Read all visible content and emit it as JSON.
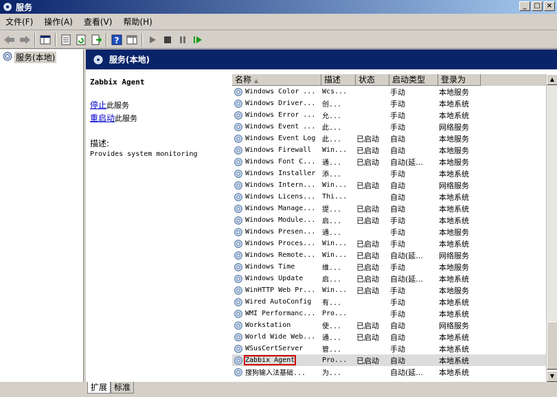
{
  "window": {
    "title": "服务",
    "min": "_",
    "max": "□",
    "close": "×"
  },
  "menu": [
    {
      "label": "文件(F)"
    },
    {
      "label": "操作(A)"
    },
    {
      "label": "查看(V)"
    },
    {
      "label": "帮助(H)"
    }
  ],
  "tree": {
    "label": "服务(本地)"
  },
  "header": {
    "title": "服务(本地)"
  },
  "details": {
    "service_name": "Zabbix Agent",
    "stop_link": "停止",
    "stop_text": "此服务",
    "restart_link": "重启动",
    "restart_text": "此服务",
    "desc_label": "描述:",
    "desc_text": "Provides system monitoring"
  },
  "columns": {
    "name": "名称",
    "desc": "描述",
    "status": "状态",
    "start": "启动类型",
    "logon": "登录为"
  },
  "rows": [
    {
      "name": "Windows Color ...",
      "desc": "Wcs...",
      "status": "",
      "start": "手动",
      "logon": "本地服务"
    },
    {
      "name": "Windows Driver...",
      "desc": "创...",
      "status": "",
      "start": "手动",
      "logon": "本地系统"
    },
    {
      "name": "Windows Error ...",
      "desc": "允...",
      "status": "",
      "start": "手动",
      "logon": "本地系统"
    },
    {
      "name": "Windows Event ...",
      "desc": "此...",
      "status": "",
      "start": "手动",
      "logon": "网络服务"
    },
    {
      "name": "Windows Event Log",
      "desc": "此...",
      "status": "已启动",
      "start": "自动",
      "logon": "本地服务"
    },
    {
      "name": "Windows Firewall",
      "desc": "Win...",
      "status": "已启动",
      "start": "自动",
      "logon": "本地服务"
    },
    {
      "name": "Windows Font C...",
      "desc": "通...",
      "status": "已启动",
      "start": "自动(延...",
      "logon": "本地服务"
    },
    {
      "name": "Windows Installer",
      "desc": "添...",
      "status": "",
      "start": "手动",
      "logon": "本地系统"
    },
    {
      "name": "Windows Intern...",
      "desc": "Win...",
      "status": "已启动",
      "start": "自动",
      "logon": "网络服务"
    },
    {
      "name": "Windows Licens...",
      "desc": "Thi...",
      "status": "",
      "start": "自动",
      "logon": "本地系统"
    },
    {
      "name": "Windows Manage...",
      "desc": "提...",
      "status": "已启动",
      "start": "自动",
      "logon": "本地系统"
    },
    {
      "name": "Windows Module...",
      "desc": "启...",
      "status": "已启动",
      "start": "手动",
      "logon": "本地系统"
    },
    {
      "name": "Windows Presen...",
      "desc": "通...",
      "status": "",
      "start": "手动",
      "logon": "本地服务"
    },
    {
      "name": "Windows Proces...",
      "desc": "Win...",
      "status": "已启动",
      "start": "手动",
      "logon": "本地系统"
    },
    {
      "name": "Windows Remote...",
      "desc": "Win...",
      "status": "已启动",
      "start": "自动(延...",
      "logon": "网络服务"
    },
    {
      "name": "Windows Time",
      "desc": "维...",
      "status": "已启动",
      "start": "手动",
      "logon": "本地服务"
    },
    {
      "name": "Windows Update",
      "desc": "启...",
      "status": "已启动",
      "start": "自动(延...",
      "logon": "本地系统"
    },
    {
      "name": "WinHTTP Web Pr...",
      "desc": "Win...",
      "status": "已启动",
      "start": "手动",
      "logon": "本地服务"
    },
    {
      "name": "Wired AutoConfig",
      "desc": "有...",
      "status": "",
      "start": "手动",
      "logon": "本地系统"
    },
    {
      "name": "WMI Performanc...",
      "desc": "Pro...",
      "status": "",
      "start": "手动",
      "logon": "本地系统"
    },
    {
      "name": "Workstation",
      "desc": "使...",
      "status": "已启动",
      "start": "自动",
      "logon": "网络服务"
    },
    {
      "name": "World Wide Web...",
      "desc": "通...",
      "status": "已启动",
      "start": "自动",
      "logon": "本地系统"
    },
    {
      "name": "WSusCertServer",
      "desc": "管...",
      "status": "",
      "start": "手动",
      "logon": "本地系统"
    },
    {
      "name": "Zabbix Agent",
      "desc": "Pro...",
      "status": "已启动",
      "start": "自动",
      "logon": "本地系统",
      "selected": true
    },
    {
      "name": "搜狗输入法基础...",
      "desc": "为...",
      "status": "",
      "start": "自动(延...",
      "logon": "本地系统"
    }
  ],
  "tabs": [
    {
      "label": "扩展"
    },
    {
      "label": "标准"
    }
  ],
  "scroll": {
    "up": "▲",
    "down": "▼"
  }
}
